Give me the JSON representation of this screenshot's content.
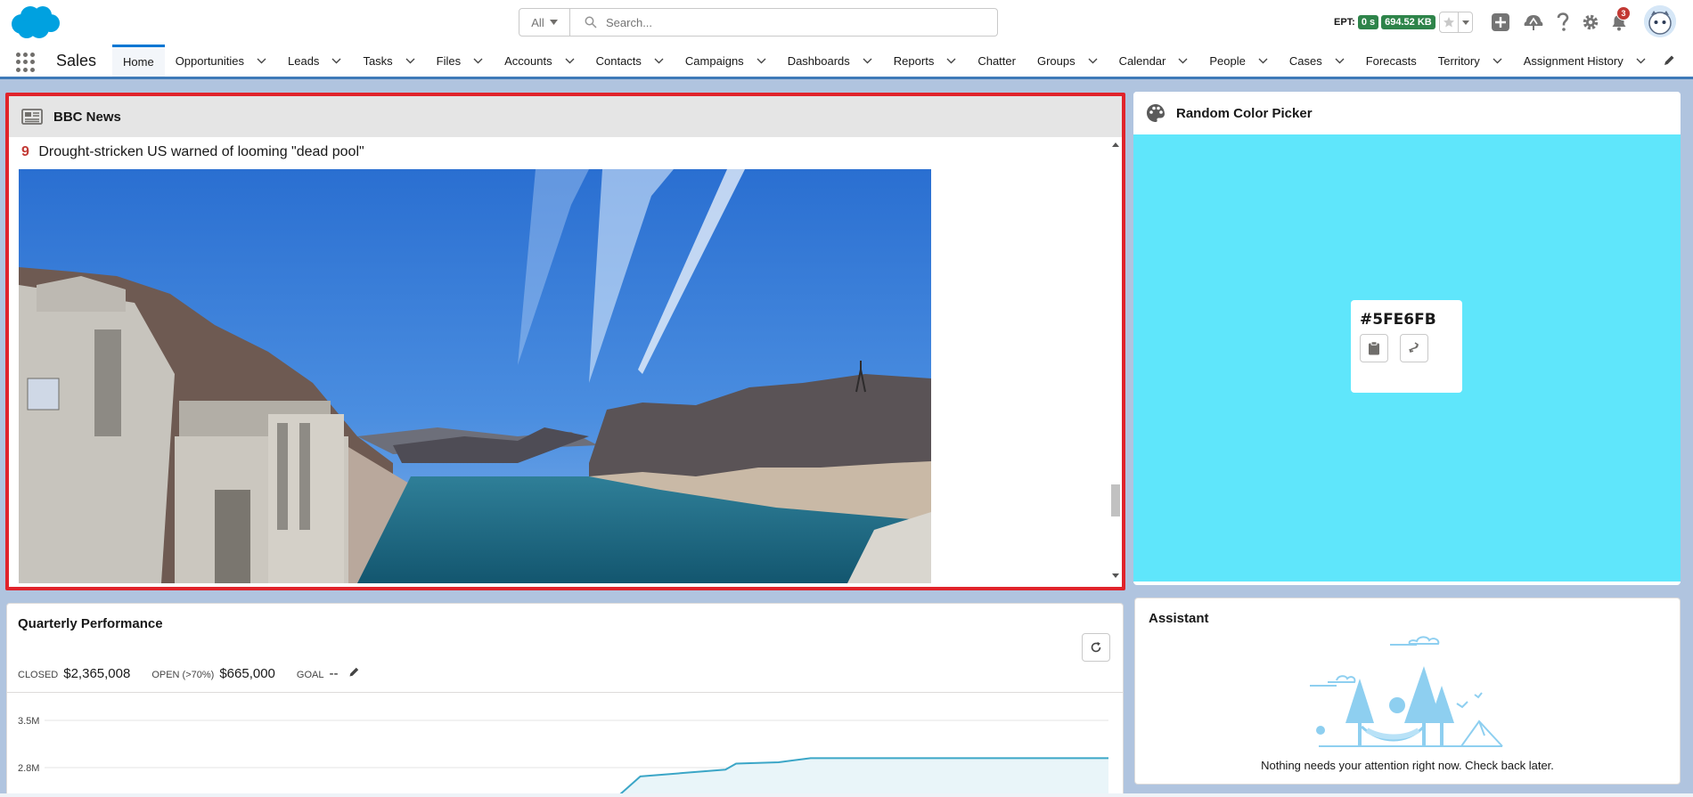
{
  "header": {
    "search": {
      "scope": "All",
      "placeholder": "Search..."
    },
    "ept": {
      "label": "EPT:",
      "time": "0 s",
      "size": "694.52 KB"
    },
    "notifications_count": "3"
  },
  "nav": {
    "app_name": "Sales",
    "items": [
      {
        "label": "Home",
        "has_menu": false,
        "active": true
      },
      {
        "label": "Opportunities",
        "has_menu": true
      },
      {
        "label": "Leads",
        "has_menu": true
      },
      {
        "label": "Tasks",
        "has_menu": true
      },
      {
        "label": "Files",
        "has_menu": true
      },
      {
        "label": "Accounts",
        "has_menu": true
      },
      {
        "label": "Contacts",
        "has_menu": true
      },
      {
        "label": "Campaigns",
        "has_menu": true
      },
      {
        "label": "Dashboards",
        "has_menu": true
      },
      {
        "label": "Reports",
        "has_menu": true
      },
      {
        "label": "Chatter",
        "has_menu": false
      },
      {
        "label": "Groups",
        "has_menu": true
      },
      {
        "label": "Calendar",
        "has_menu": true
      },
      {
        "label": "People",
        "has_menu": true
      },
      {
        "label": "Cases",
        "has_menu": true
      },
      {
        "label": "Forecasts",
        "has_menu": false
      },
      {
        "label": "Territory",
        "has_menu": true
      },
      {
        "label": "Assignment History",
        "has_menu": true
      }
    ]
  },
  "bbc": {
    "title": "BBC News",
    "story_number": "9",
    "story_headline": "Drought-stricken US warned of looming \"dead pool\""
  },
  "color_picker": {
    "title": "Random Color Picker",
    "hex": "#5FE6FB",
    "color": "#5FE6FB"
  },
  "performance": {
    "title": "Quarterly Performance",
    "closed_label": "CLOSED",
    "closed_value": "$2,365,008",
    "open_label": "OPEN (>70%)",
    "open_value": "$665,000",
    "goal_label": "GOAL",
    "goal_value": "--",
    "chart_data": {
      "type": "area",
      "y_ticks": [
        "3.5M",
        "2.8M"
      ],
      "x": [
        0.53,
        0.56,
        0.6,
        0.64,
        0.65,
        0.69,
        0.72,
        1.0
      ],
      "values": [
        2.25,
        2.67,
        2.72,
        2.77,
        2.86,
        2.88,
        2.94,
        2.94
      ]
    }
  },
  "assistant": {
    "title": "Assistant",
    "message": "Nothing needs your attention right now. Check back later."
  },
  "colors": {
    "brand": "#0176D3",
    "highlight_border": "#E0232B",
    "chart_line": "#3BA6C7",
    "background": "#B0C4DF"
  }
}
